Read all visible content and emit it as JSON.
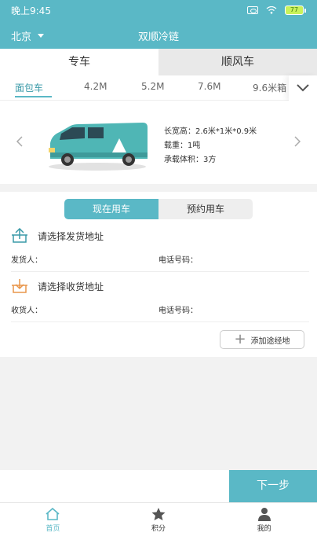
{
  "status": {
    "time": "晚上9:45",
    "battery": "77"
  },
  "nav": {
    "city": "北京",
    "title": "双顺冷链"
  },
  "top_tabs": [
    {
      "label": "专车"
    },
    {
      "label": "顺风车"
    }
  ],
  "size_tabs": [
    {
      "label": "面包车"
    },
    {
      "label": "4.2M"
    },
    {
      "label": "5.2M"
    },
    {
      "label": "7.6M"
    },
    {
      "label": "9.6米箱"
    }
  ],
  "vehicle": {
    "dimensions": "长宽高：2.6米*1米*0.9米",
    "load": "载重：1吨",
    "volume": "承载体积：3方"
  },
  "use_tabs": [
    {
      "label": "现在用车"
    },
    {
      "label": "预约用车"
    }
  ],
  "pickup": {
    "prompt": "请选择发货地址",
    "person_label": "发货人：",
    "phone_label": "电话号码："
  },
  "delivery": {
    "prompt": "请选择收货地址",
    "person_label": "收货人：",
    "phone_label": "电话号码："
  },
  "waypoint_label": "添加途经地",
  "next_label": "下一步",
  "tabbar": [
    {
      "label": "首页"
    },
    {
      "label": "积分"
    },
    {
      "label": "我的"
    }
  ],
  "colors": {
    "accent": "#5ab8c6"
  },
  "icons": {
    "more": "chevron-down-icon",
    "prev": "chevron-left-icon",
    "next": "chevron-right-icon",
    "pickup": "upload-box-icon",
    "delivery": "download-box-icon",
    "home": "home-icon",
    "points": "star-icon",
    "mine": "person-icon"
  }
}
